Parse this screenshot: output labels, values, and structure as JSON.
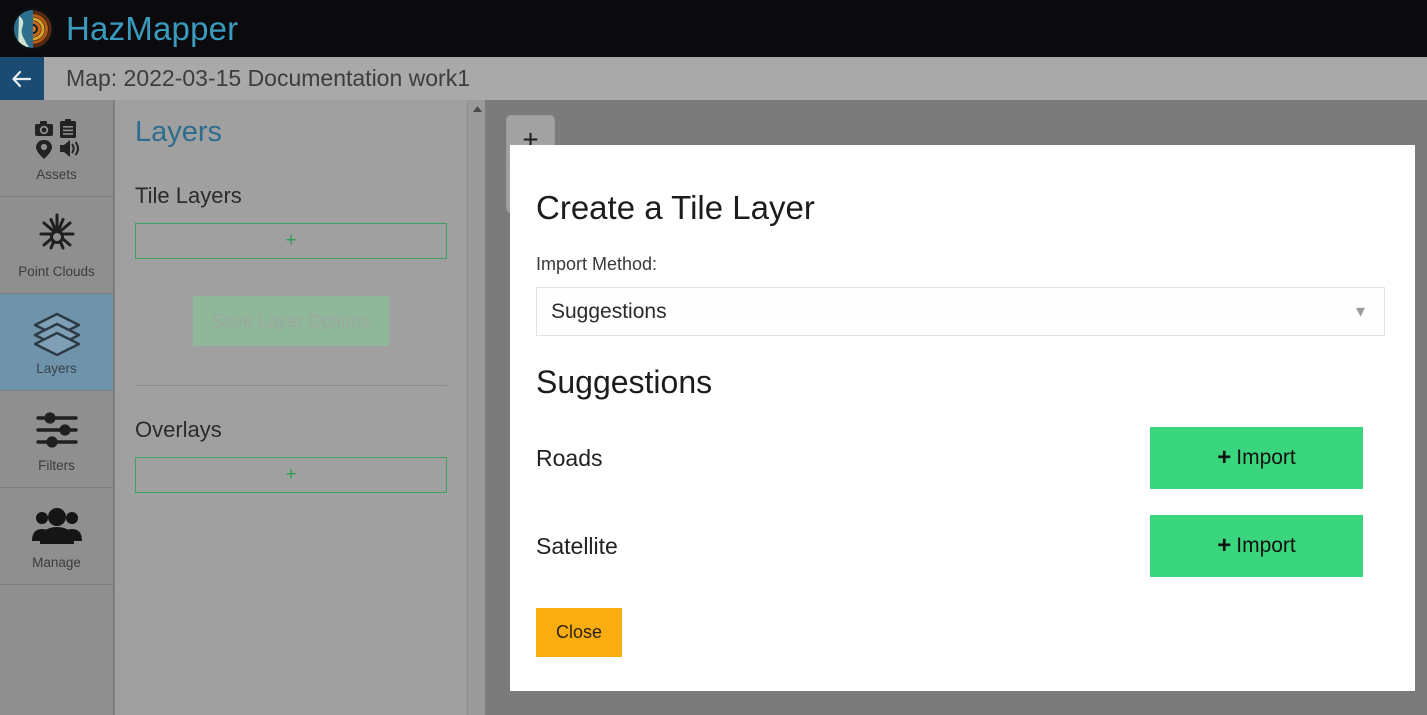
{
  "brand": {
    "title": "HazMapper",
    "logo_icon": "globe-seismic-logo-icon",
    "accent_color": "#3a9bbf"
  },
  "titlebar": {
    "back_icon": "arrow-left-icon",
    "map_title": "Map: 2022-03-15 Documentation work1"
  },
  "sidebar": {
    "items": [
      {
        "label": "Assets",
        "icon": "assets-icon",
        "active": false
      },
      {
        "label": "Point Clouds",
        "icon": "point-cloud-icon",
        "active": false
      },
      {
        "label": "Layers",
        "icon": "layers-icon",
        "active": true
      },
      {
        "label": "Filters",
        "icon": "filters-sliders-icon",
        "active": false
      },
      {
        "label": "Manage",
        "icon": "manage-people-icon",
        "active": false
      }
    ],
    "active_color": "#6f93ab"
  },
  "panel": {
    "heading": "Layers",
    "tile_layers": {
      "title": "Tile Layers",
      "add_label": "+"
    },
    "save_layer_options_label": "Save Layer Options",
    "overlays": {
      "title": "Overlays",
      "add_label": "+"
    },
    "scrollbar": {
      "up_icon": "caret-up-icon"
    }
  },
  "map": {
    "zoom_in_label": "+",
    "zoom_control_icon": "zoom-control"
  },
  "modal": {
    "title": "Create a Tile Layer",
    "import_method_label": "Import Method:",
    "import_method_value": "Suggestions",
    "import_method_options": [
      "Suggestions"
    ],
    "caret_icon": "chevron-down-icon",
    "suggestions_heading": "Suggestions",
    "suggestions": [
      {
        "name": "Roads",
        "import_label": "Import",
        "plus": "+"
      },
      {
        "name": "Satellite",
        "import_label": "Import",
        "plus": "+"
      }
    ],
    "close_label": "Close",
    "import_button_color": "#3ad67e",
    "close_button_color": "#f9ad10"
  }
}
